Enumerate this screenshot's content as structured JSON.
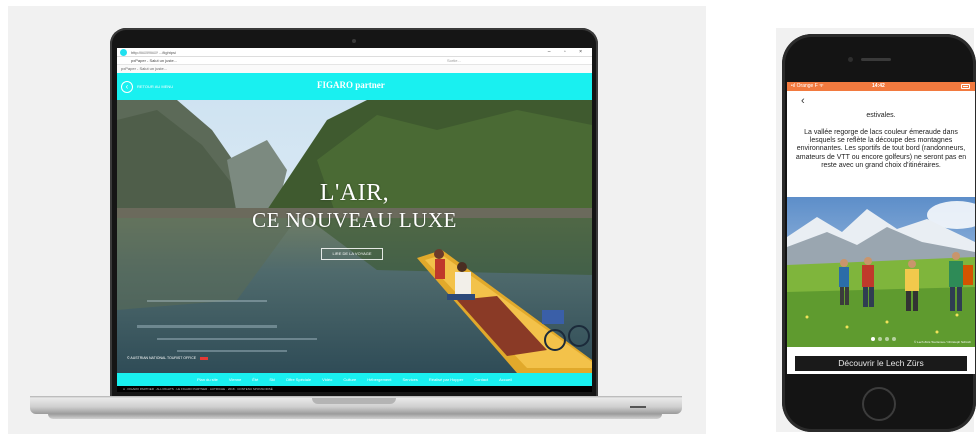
{
  "laptop": {
    "browser": {
      "tab_title": "http:///////////////// .../tightpsi",
      "url": "pxPaper - Salut un juste...",
      "page_info": "Sortie...",
      "window_controls": "– ▫ ×",
      "bookmarks": "pxPaper - Salut un juste..."
    },
    "site": {
      "back_label": "RETOUR AU MENU",
      "brand": "FIGARO partner",
      "hero_title_line1": "L'AIR,",
      "hero_title_line2": "CE NOUVEAU LUXE",
      "hero_cta": "LIRE DE LA VOYAGE",
      "photo_credit": "© AUSTRIAN NATIONAL TOURIST OFFICE",
      "nav": [
        "Plan du site",
        "Vienne",
        "Été",
        "Ski",
        "Offre Spéciale",
        "Vidéo",
        "Culture",
        "Hébergement",
        "Services",
        "Réalisé par Hopper",
        "Contact",
        "Accueil"
      ],
      "bottom_strip": "A · FIGARO PARTNER · ALL RIGHTS · LE FIGARO PARTNER · AUTRICHE · 2018 · CONTENU SPONSORISÉ"
    },
    "colors": {
      "accent": "#19f0f0"
    }
  },
  "phone": {
    "status": {
      "carrier": "•ıl Orange F ᯤ",
      "time": "14:42"
    },
    "back_icon": "chevron-left",
    "text_top": "estivales.",
    "text_body": "La vallée regorge de lacs couleur émeraude dans lesquels se reflète la découpe des montagnes environnantes. Les sportifs de tout bord (randonneurs, amateurs de VTT ou encore golfeurs) ne seront pas en reste avec un grand choix d'itinéraires.",
    "photo_credit": "© Lech Zürs Tourismus / Christoph Schöch",
    "cta": "Découvrir le Lech Zürs",
    "colors": {
      "status_bar": "#f27a3f"
    }
  }
}
